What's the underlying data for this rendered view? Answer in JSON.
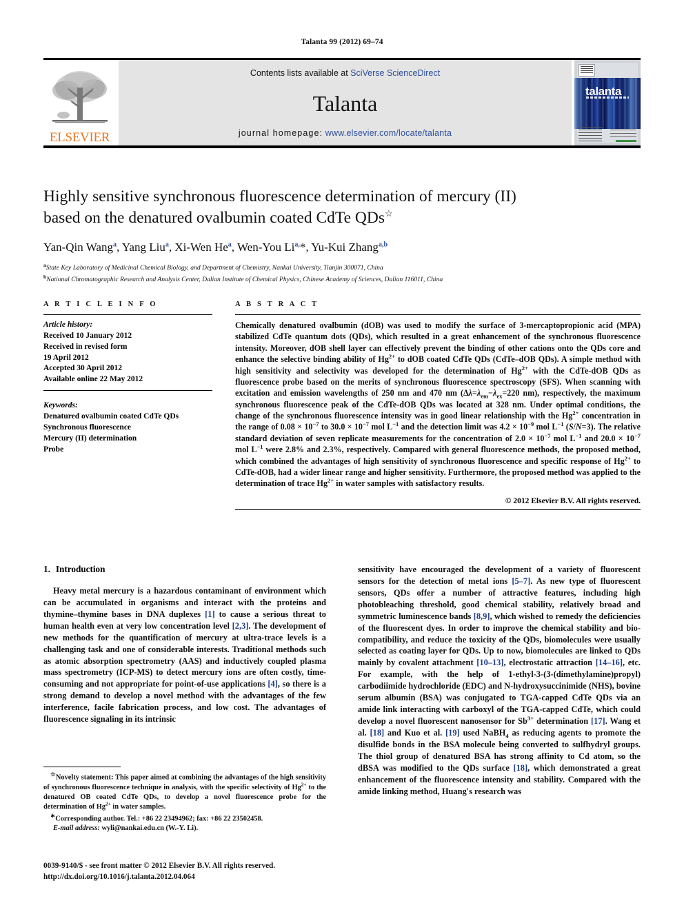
{
  "running_head": "Talanta 99 (2012) 69–74",
  "masthead": {
    "contents_prefix": "Contents lists available at ",
    "contents_link": "SciVerse ScienceDirect",
    "journal_name": "Talanta",
    "homepage_label": "journal homepage:",
    "homepage_link": "www.elsevier.com/locate/talanta",
    "publisher": "ELSEVIER",
    "cover_title": "talanta",
    "link_color": "#2F4F9E",
    "band_color": "#e4e4e4",
    "elsevier_orange": "#E87722"
  },
  "title": {
    "line1": "Highly sensitive synchronous fluorescence determination of mercury (II)",
    "line2": "based on the denatured ovalbumin coated CdTe QDs",
    "footnote_marker": "☆"
  },
  "authors": [
    {
      "name": "Yan-Qin Wang",
      "sup": "a",
      "sep": ", "
    },
    {
      "name": "Yang Liu",
      "sup": "a",
      "sep": ", "
    },
    {
      "name": "Xi-Wen He",
      "sup": "a",
      "sep": ", "
    },
    {
      "name": "Wen-You Li",
      "sup": "a,",
      "star": "*",
      "sep": ", "
    },
    {
      "name": "Yu-Kui Zhang",
      "sup": "a,b",
      "sep": ""
    }
  ],
  "affiliations": [
    {
      "label": "a",
      "text": "State Key Laboratory of Medicinal Chemical Biology, and Department of Chemistry, Nankai University, Tianjin 300071, China"
    },
    {
      "label": "b",
      "text": "National Chromatographic Research and Analysis Center, Dalian Institute of Chemical Physics, Chinese Academy of Sciences, Dalian 116011, China"
    }
  ],
  "article_info": {
    "heading": "A R T I C L E   I N F O",
    "history_title": "Article history:",
    "history": [
      "Received 10 January 2012",
      "Received in revised form",
      "19 April 2012",
      "Accepted 30 April 2012",
      "Available online 22 May 2012"
    ],
    "keywords_title": "Keywords:",
    "keywords": [
      "Denatured ovalbumin coated CdTe QDs",
      "Synchronous fluorescence",
      "Mercury (II) determination",
      "Probe"
    ]
  },
  "abstract": {
    "heading": "A B S T R A C T",
    "copyright": "© 2012 Elsevier B.V. All rights reserved.",
    "paragraphs": [
      "Chemically denatured ovalbumin (dOB) was used to modify the surface of 3-mercaptopropionic acid (MPA) stabilized CdTe quantum dots (QDs), which resulted in a great enhancement of the synchronous fluorescence intensity. Moreover, dOB shell layer can effectively prevent the binding of other cations onto the QDs core and enhance the selective binding ability of Hg2+ to dOB coated CdTe QDs (CdTe–dOB QDs). A simple method with high sensitivity and selectivity was developed for the determination of Hg2+ with the CdTe-dOB QDs as fluorescence probe based on the merits of synchronous fluorescence spectroscopy (SFS). When scanning with excitation and emission wavelengths of 250 nm and 470 nm (Δλ=λem−λex=220 nm), respectively, the maximum synchronous fluorescence peak of the CdTe-dOB QDs was located at 328 nm. Under optimal conditions, the change of the synchronous fluorescence intensity was in good linear relationship with the Hg2+ concentration in the range of 0.08 × 10−7 to 30.0 × 10−7 mol L−1 and the detection limit was 4.2 × 10−9 mol L−1 (S/N=3). The relative standard deviation of seven replicate measurements for the concentration of 2.0 × 10−7 mol L−1 and 20.0 × 10−7 mol L−1 were 2.8% and 2.3%, respectively. Compared with general fluorescence methods, the proposed method, which combined the advantages of high sensitivity of synchronous fluorescence and specific response of Hg2+ to CdTe-dOB, had a wider linear range and higher sensitivity. Furthermore, the proposed method was applied to the determination of trace Hg2+ in water samples with satisfactory results."
    ]
  },
  "introduction": {
    "number": "1.",
    "title": "Introduction",
    "left_paragraph": "Heavy metal mercury is a hazardous contaminant of environment which can be accumulated in organisms and interact with the proteins and thymine–thymine bases in DNA duplexes [1] to cause a serious threat to human health even at very low concentration level [2,3]. The development of new methods for the quantification of mercury at ultra-trace levels is a challenging task and one of considerable interests. Traditional methods such as atomic absorption spectrometry (AAS) and inductively coupled plasma mass spectrometry (ICP-MS) to detect mercury ions are often costly, time-consuming and not appropriate for point-of-use applications [4], so there is a strong demand to develop a novel method with the advantages of the few interference, facile fabrication process, and low cost. The advantages of fluorescence signaling in its intrinsic",
    "right_paragraph": "sensitivity have encouraged the development of a variety of fluorescent sensors for the detection of metal ions [5–7]. As new type of fluorescent sensors, QDs offer a number of attractive features, including high photobleaching threshold, good chemical stability, relatively broad and symmetric luminescence bands [8,9], which wished to remedy the deficiencies of the fluorescent dyes. In order to improve the chemical stability and bio-compatibility, and reduce the toxicity of the QDs, biomolecules were usually selected as coating layer for QDs. Up to now, biomolecules are linked to QDs mainly by covalent attachment [10–13], electrostatic attraction [14–16], etc. For example, with the help of 1-ethyl-3-(3-(dimethylamine)propyl) carbodiimide hydrochloride (EDC) and N-hydroxysuccinimide (NHS), bovine serum albumin (BSA) was conjugated to TGA-capped CdTe QDs via an amide link interacting with carboxyl of the TGA-capped CdTe, which could develop a novel fluorescent nanosensor for Sb3+ determination [17]. Wang et al. [18] and Kuo et al. [19] used NaBH4 as reducing agents to promote the disulfide bonds in the BSA molecule being converted to sulfhydryl groups. The thiol group of denatured BSA has strong affinity to Cd atom, so the dBSA was modified to the QDs surface [18], which demonstrated a great enhancement of the fluorescence intensity and stability. Compared with the amide linking method, Huang's research was"
  },
  "footnotes": {
    "novelty": "Novelty statement: This paper aimed at combining the advantages of the high sensitivity of synchronous fluorescence technique in analysis, with the specific selectivity of Hg2+ to the denatured OB coated CdTe QDs, to develop a novel fluorescence probe for the determination of Hg2+ in water samples.",
    "corresponding": "Corresponding author. Tel.: +86 22 23494962; fax: +86 22 23502458.",
    "email_label": "E-mail address:",
    "email": "wyli@nankai.edu.cn (W.-Y. Li)."
  },
  "imprint": {
    "line1": "0039-9140/$ - see front matter © 2012 Elsevier B.V. All rights reserved.",
    "line2": "http://dx.doi.org/10.1016/j.talanta.2012.04.064"
  }
}
